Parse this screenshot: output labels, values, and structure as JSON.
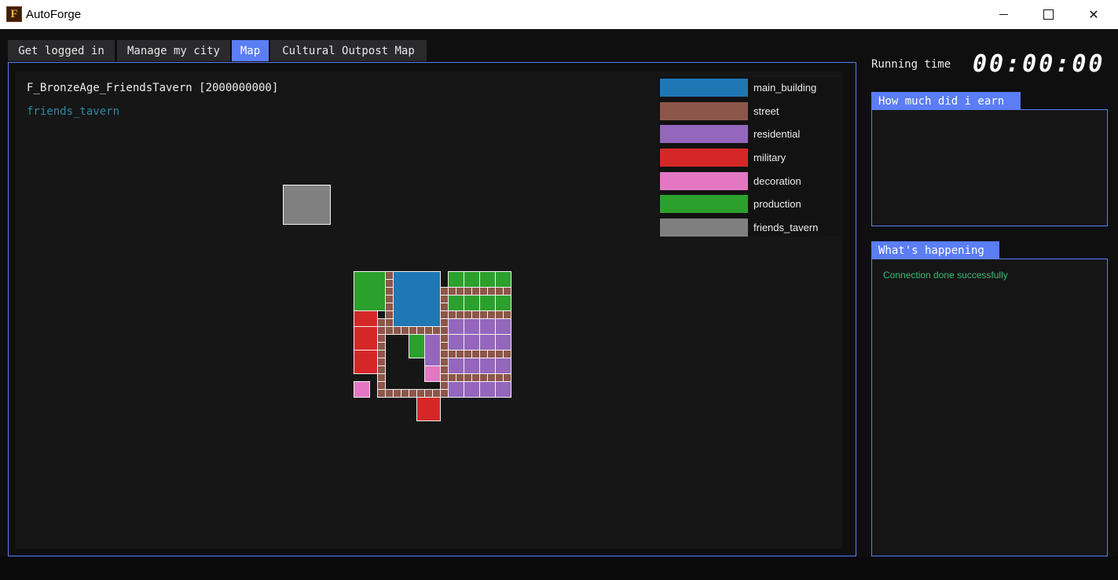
{
  "window": {
    "app_icon_letter": "F",
    "title": "AutoForge",
    "controls": {
      "minimize": "minimize-icon",
      "maximize": "maximize-icon",
      "close": "close-icon",
      "close_glyph": "✕"
    }
  },
  "tabs": [
    {
      "label": "Get logged in",
      "active": false
    },
    {
      "label": "Manage my city",
      "active": false
    },
    {
      "label": "Map",
      "active": true
    },
    {
      "label": "Cultural Outpost Map",
      "active": false
    }
  ],
  "map": {
    "title": "F_BronzeAge_FriendsTavern [2000000000]",
    "subtitle": "friends_tavern",
    "legend": [
      {
        "label": "main_building",
        "color": "#1f77b4"
      },
      {
        "label": "street",
        "color": "#8c564b"
      },
      {
        "label": "residential",
        "color": "#9467bd"
      },
      {
        "label": "military",
        "color": "#d62728"
      },
      {
        "label": "decoration",
        "color": "#e377c2"
      },
      {
        "label": "production",
        "color": "#2ca02c"
      },
      {
        "label": "friends_tavern",
        "color": "#7f7f7f"
      }
    ]
  },
  "sidebar": {
    "running_time_label": "Running time",
    "running_time_value": "00:00:00",
    "earn_title": "How much did i earn",
    "happening_title": "What's happening",
    "log": [
      "Connection done successfully"
    ]
  },
  "colors": {
    "accent": "#5b7df5",
    "log_text": "#3fba7a",
    "subtitle": "#2e86a5"
  }
}
